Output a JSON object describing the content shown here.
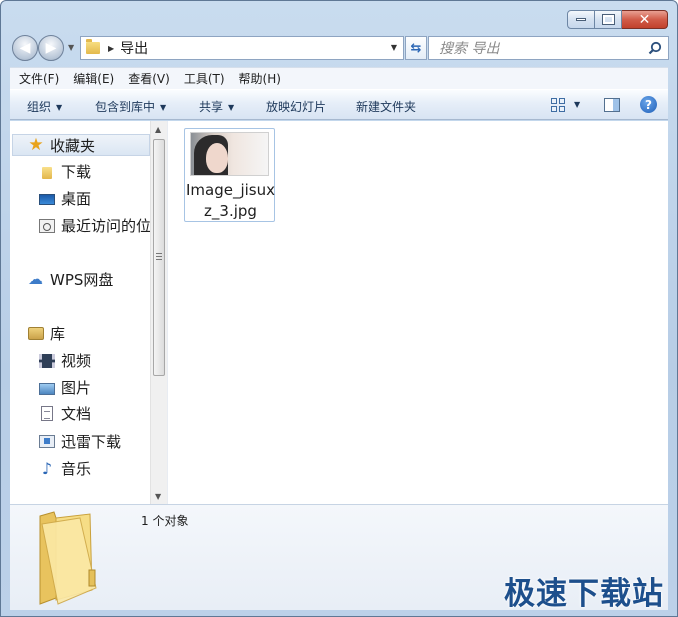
{
  "window": {
    "address": {
      "current_folder": "导出"
    },
    "search": {
      "placeholder": "搜索 导出"
    }
  },
  "menu": [
    "文件(F)",
    "编辑(E)",
    "查看(V)",
    "工具(T)",
    "帮助(H)"
  ],
  "toolbar": {
    "organize": "组织",
    "include_in_library": "包含到库中",
    "share": "共享",
    "slideshow": "放映幻灯片",
    "new_folder": "新建文件夹"
  },
  "sidebar": {
    "favorites": {
      "label": "收藏夹",
      "items": [
        "下载",
        "桌面",
        "最近访问的位"
      ]
    },
    "wps_drive": "WPS网盘",
    "libraries": {
      "label": "库",
      "items": [
        "视频",
        "图片",
        "文档",
        "迅雷下载",
        "音乐"
      ]
    }
  },
  "files": [
    {
      "name": "Image_jisuxz_3.jpg",
      "type": "image"
    }
  ],
  "details": {
    "item_count": "1 个对象"
  },
  "watermark": "极速下载站",
  "colors": {
    "accent": "#1d4f8c",
    "close_button": "#c2412c"
  }
}
